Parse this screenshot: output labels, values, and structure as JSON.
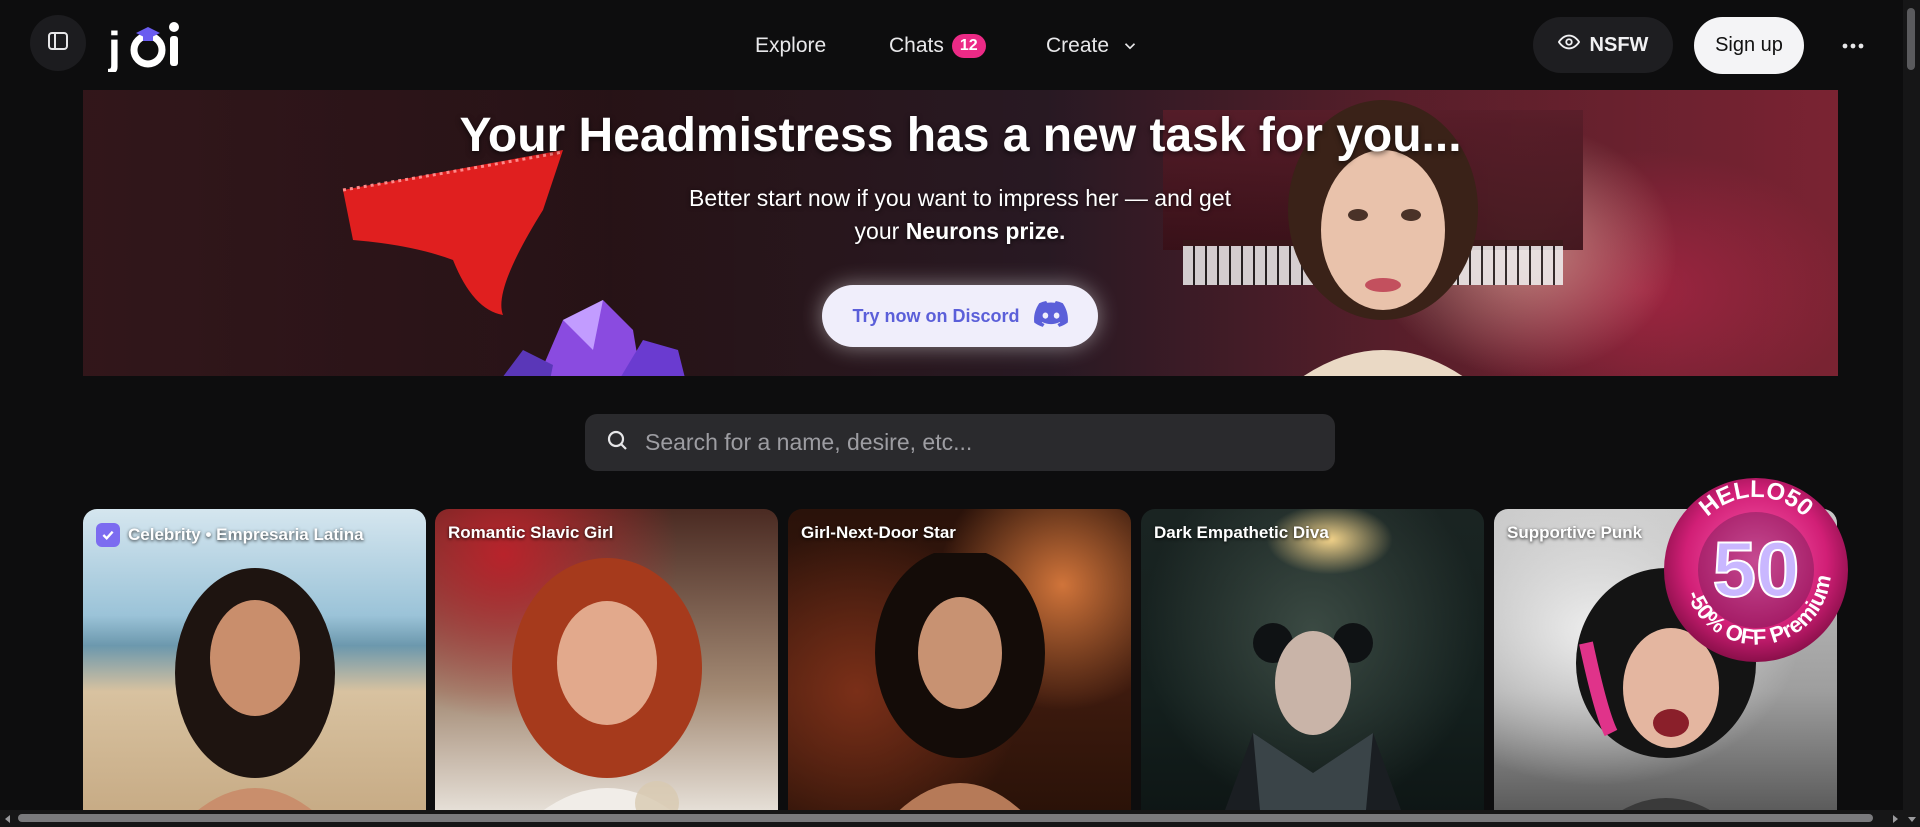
{
  "header": {
    "logo_text": "joi",
    "nav": {
      "explore": "Explore",
      "chats": "Chats",
      "chats_count": "12",
      "create": "Create"
    },
    "nsfw_label": "NSFW",
    "signup_label": "Sign up"
  },
  "banner": {
    "title": "Your Headmistress has a new task for you...",
    "subtitle_line1": "Better start now if you want to impress her — and get",
    "subtitle_prefix": "your",
    "subtitle_bold": "Neurons prize.",
    "cta_label": "Try now on Discord"
  },
  "search": {
    "placeholder": "Search for a name, desire, etc..."
  },
  "cards": [
    {
      "label": "Celebrity • Empresaria Latina",
      "verified": true
    },
    {
      "label": "Romantic Slavic Girl"
    },
    {
      "label": "Girl-Next-Door Star"
    },
    {
      "label": "Dark Empathetic Diva"
    },
    {
      "label": "Supportive Punk"
    }
  ],
  "promo": {
    "code": "HELLO50",
    "number": "50",
    "text": "-50% OFF Premium"
  },
  "colors": {
    "background": "#0d0d0e",
    "badge": "#ec2a86",
    "discord": "#5b5fd9",
    "accent": "#7c6cf0"
  }
}
